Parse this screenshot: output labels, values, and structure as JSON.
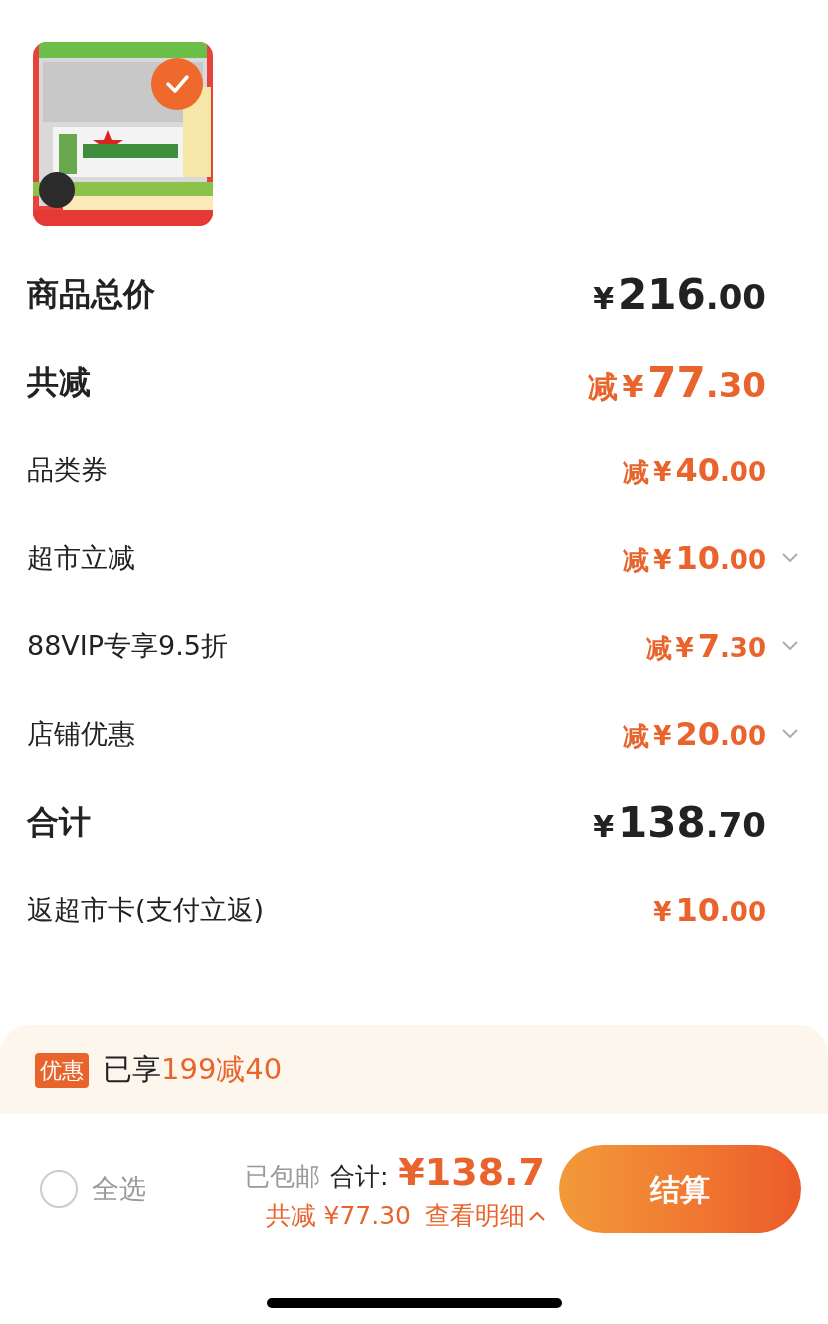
{
  "product": {
    "selected": true
  },
  "rows": [
    {
      "kind": "major",
      "label": "商品总价",
      "prefix": "",
      "amount": "¥216.00",
      "accent": false,
      "expandable": false
    },
    {
      "kind": "major",
      "label": "共减",
      "prefix": "减",
      "amount": "¥77.30",
      "accent": true,
      "expandable": false
    },
    {
      "kind": "minor",
      "label": "品类券",
      "prefix": "减",
      "amount": "¥40.00",
      "accent": true,
      "expandable": false
    },
    {
      "kind": "minor",
      "label": "超市立减",
      "prefix": "减",
      "amount": "¥10.00",
      "accent": true,
      "expandable": true
    },
    {
      "kind": "minor",
      "label": "88VIP专享9.5折",
      "prefix": "减",
      "amount": "¥7.30",
      "accent": true,
      "expandable": true
    },
    {
      "kind": "minor",
      "label": "店铺优惠",
      "prefix": "减",
      "amount": "¥20.00",
      "accent": true,
      "expandable": true
    },
    {
      "kind": "total",
      "label": "合计",
      "prefix": "",
      "amount": "¥138.70",
      "accent": false,
      "expandable": false
    },
    {
      "kind": "minor",
      "label": "返超市卡(支付立返)",
      "prefix": "",
      "amount": "¥10.00",
      "accent": true,
      "expandable": false
    }
  ],
  "promo": {
    "badge": "优惠",
    "text": "已享",
    "highlight": "199减40"
  },
  "footer": {
    "select_all": {
      "label": "全选",
      "checked": false
    },
    "shipping": "已包邮",
    "total_label": "合计:",
    "total": "¥138.7",
    "discount": "共减 ¥77.30",
    "details": "查看明细",
    "checkout": "结算"
  }
}
